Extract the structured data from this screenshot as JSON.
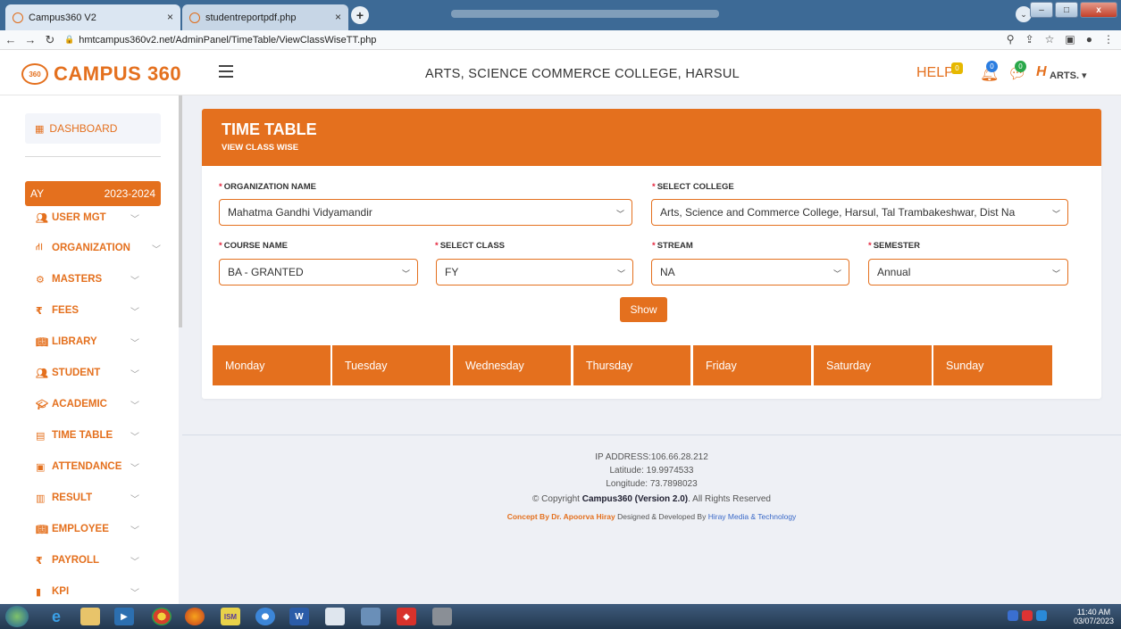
{
  "browser": {
    "tabs": [
      {
        "title": "Campus360 V2",
        "close": "×"
      },
      {
        "title": "studentreportpdf.php",
        "close": "×"
      }
    ],
    "new_tab": "+",
    "url": "hmtcampus360v2.net/AdminPanel/TimeTable/ViewClassWiseTT.php"
  },
  "header": {
    "logo_badge": "360",
    "logo_text": "CAMPUS 360",
    "college": "ARTS, SCIENCE COMMERCE COLLEGE, HARSUL",
    "help": "HELP",
    "help_count": "0",
    "notif_count": "0",
    "msg_count": "0",
    "user": "ARTS. ▾"
  },
  "sidebar": {
    "dashboard": "DASHBOARD",
    "ay_label": "AY",
    "ay_value": "2023-2024",
    "items": [
      {
        "label": "USER MGT",
        "icon": "users-icon"
      },
      {
        "label": "ORGANIZATION",
        "icon": "org-icon"
      },
      {
        "label": "MASTERS",
        "icon": "gear-icon"
      },
      {
        "label": "FEES",
        "icon": "rupee-icon"
      },
      {
        "label": "LIBRARY",
        "icon": "book-icon"
      },
      {
        "label": "STUDENT",
        "icon": "users-icon"
      },
      {
        "label": "ACADEMIC",
        "icon": "graduation-icon"
      },
      {
        "label": "TIME TABLE",
        "icon": "calendar-icon"
      },
      {
        "label": "ATTENDANCE",
        "icon": "id-card-icon"
      },
      {
        "label": "RESULT",
        "icon": "result-icon"
      },
      {
        "label": "EMPLOYEE",
        "icon": "book-icon"
      },
      {
        "label": "PAYROLL",
        "icon": "rupee-icon"
      },
      {
        "label": "KPI",
        "icon": "bar-chart-icon"
      }
    ]
  },
  "page": {
    "title": "TIME TABLE",
    "subtitle": "VIEW CLASS WISE",
    "fields": {
      "organization": {
        "label": "ORGANIZATION NAME",
        "value": "Mahatma Gandhi Vidyamandir"
      },
      "college": {
        "label": "SELECT COLLEGE",
        "value": "Arts, Science and Commerce College, Harsul, Tal Trambakeshwar, Dist Na"
      },
      "course": {
        "label": "COURSE NAME",
        "value": "BA - GRANTED"
      },
      "class": {
        "label": "SELECT CLASS",
        "value": "FY"
      },
      "stream": {
        "label": "STREAM",
        "value": "NA"
      },
      "semester": {
        "label": "SEMESTER",
        "value": "Annual"
      }
    },
    "show_button": "Show",
    "days": [
      "Monday",
      "Tuesday",
      "Wednesday",
      "Thursday",
      "Friday",
      "Saturday",
      "Sunday"
    ]
  },
  "footer": {
    "ip": "IP ADDRESS:106.66.28.212",
    "lat": "Latitude: 19.9974533",
    "lon": "Longitude: 73.7898023",
    "copy_pre": "© Copyright ",
    "copy_brand": "Campus360 (Version 2.0)",
    "copy_post": ". All Rights Reserved",
    "concept": "Concept By Dr. Apoorva Hiray",
    "designed": " Designed & Developed By ",
    "company": "Hiray Media & Technology"
  },
  "taskbar": {
    "time": "11:40 AM",
    "date": "03/07/2023"
  }
}
